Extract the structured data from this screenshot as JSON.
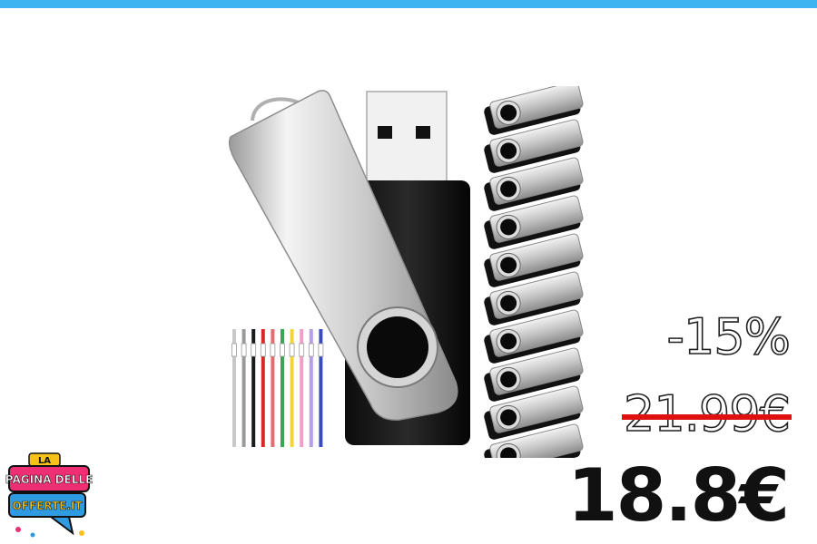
{
  "banner": {
    "accent_color": "#3db4f2"
  },
  "product": {
    "image": "usb-flash-drive-pack",
    "drive_count": 10,
    "lanyard_colors": [
      "#c8c8c8",
      "#9a9a9a",
      "#1a1a1a",
      "#d62828",
      "#e56b6f",
      "#3aa655",
      "#f2d43d",
      "#f29ec6",
      "#b5a0e6",
      "#3b4cc0"
    ]
  },
  "pricing": {
    "discount": "-15%",
    "old_price": "21.99€",
    "new_price": "18.8€",
    "strike_color": "#e01010"
  },
  "logo": {
    "line1": "LA",
    "line2": "PAGINA DELLE",
    "line3": "OFFERTE.IT"
  }
}
